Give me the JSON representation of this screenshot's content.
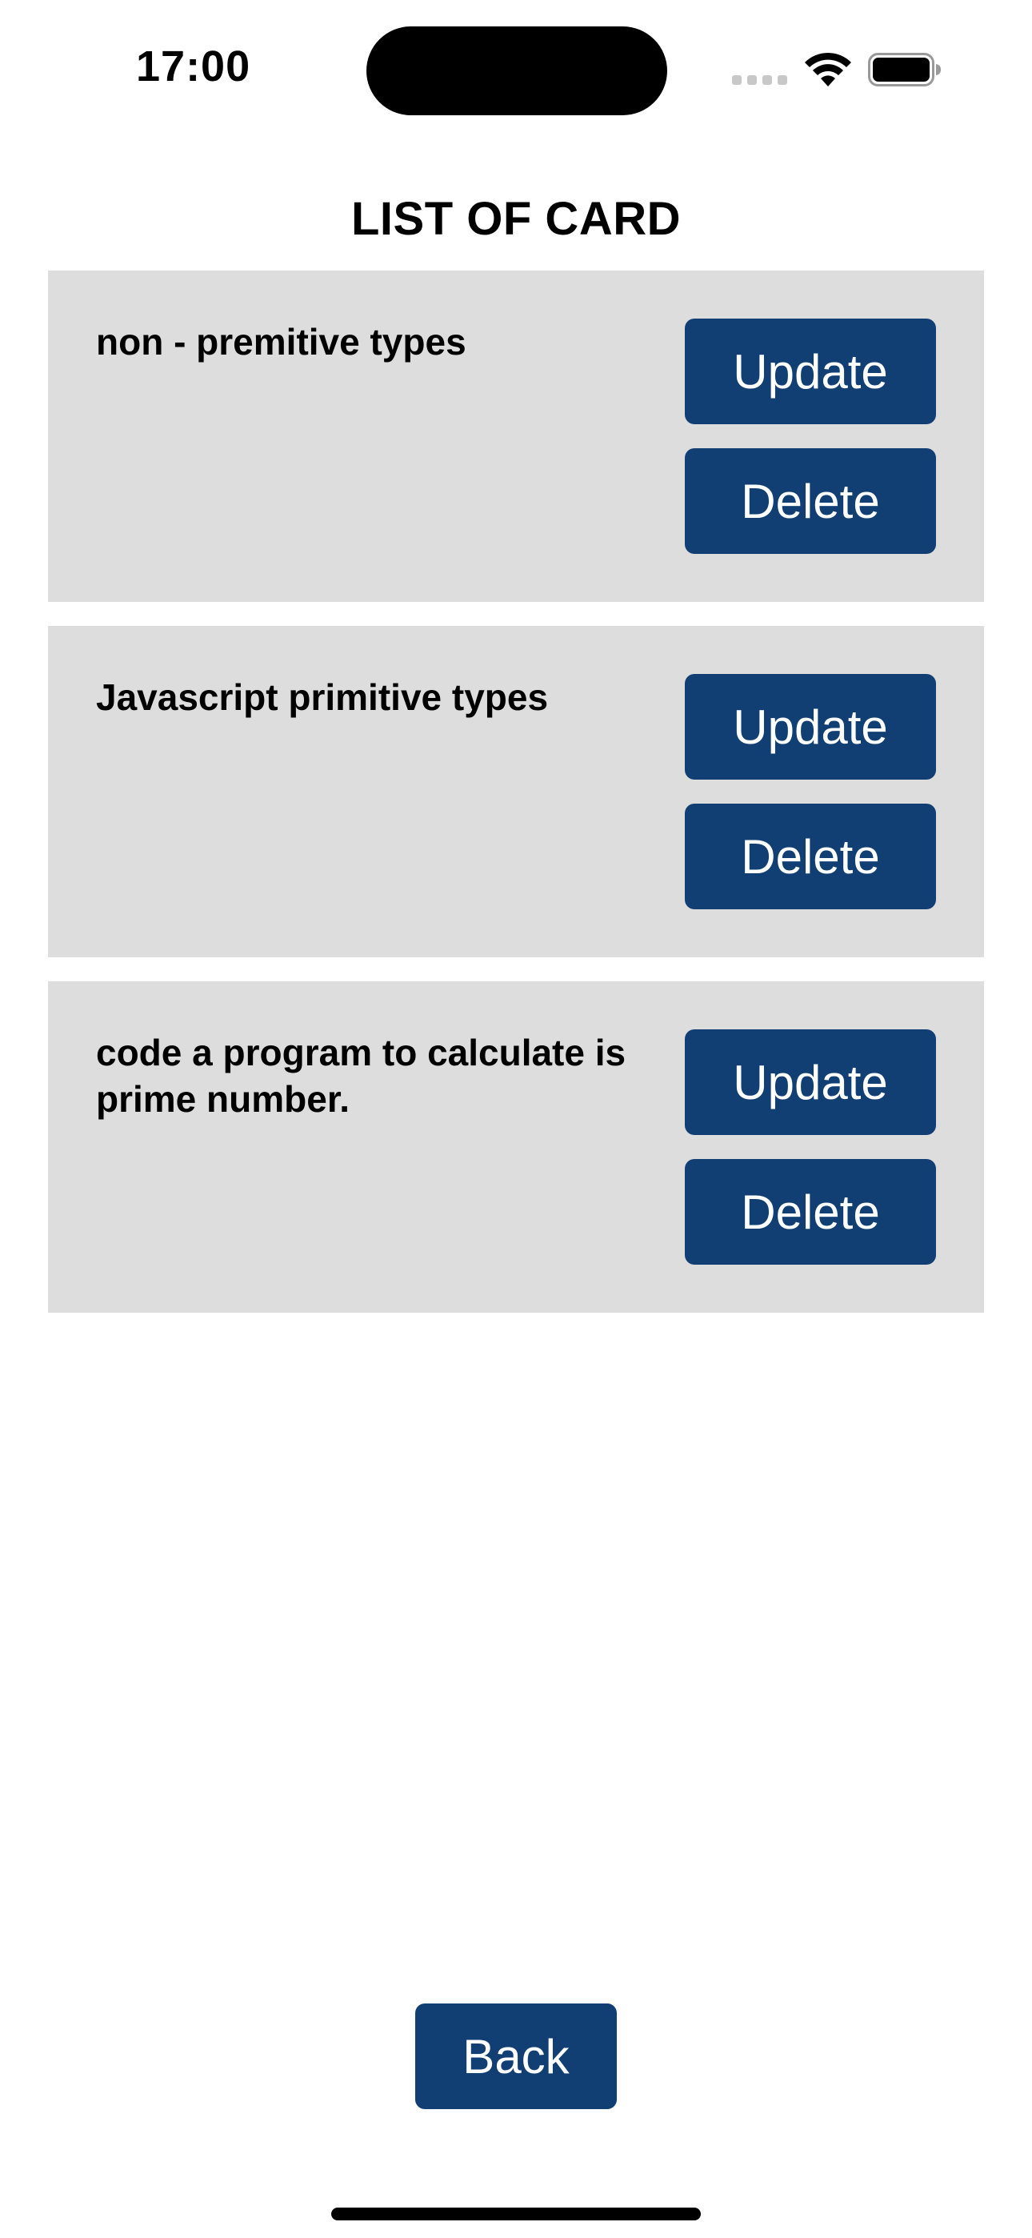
{
  "status_bar": {
    "time": "17:00",
    "icons": [
      "signal-icon",
      "wifi-icon",
      "battery-icon"
    ]
  },
  "page": {
    "title": "LIST OF CARD"
  },
  "cards": [
    {
      "title": "non - premitive types",
      "update_label": "Update",
      "delete_label": "Delete"
    },
    {
      "title": "Javascript primitive types",
      "update_label": "Update",
      "delete_label": "Delete"
    },
    {
      "title": "code a program to calculate is prime number.",
      "update_label": "Update",
      "delete_label": "Delete"
    }
  ],
  "footer": {
    "back_label": "Back"
  },
  "colors": {
    "button_bg": "#123f73",
    "card_bg": "#dddddd",
    "button_text": "#ffffff"
  }
}
